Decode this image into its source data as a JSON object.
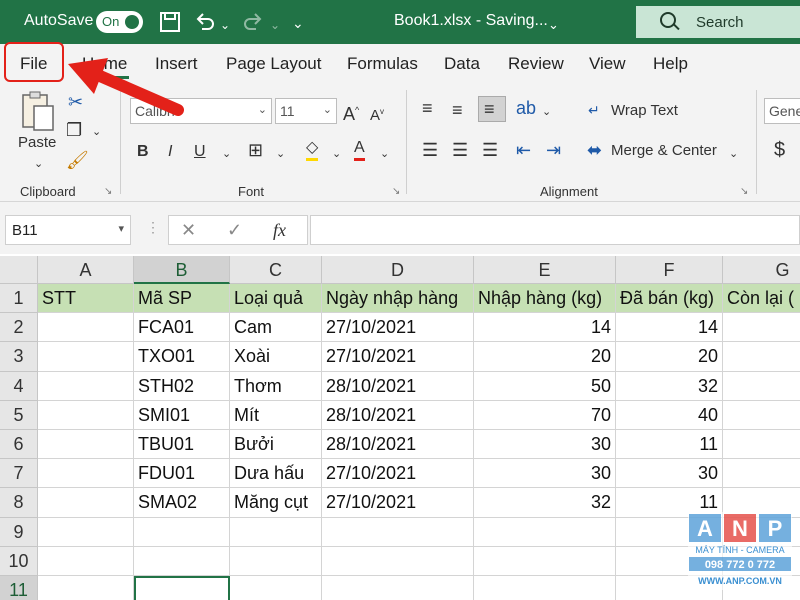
{
  "titlebar": {
    "autosave_label": "AutoSave",
    "autosave_state": "On",
    "doc_title": "Book1.xlsx  -  Saving...",
    "search_label": "Search"
  },
  "tabs": [
    "File",
    "Home",
    "Insert",
    "Page Layout",
    "Formulas",
    "Data",
    "Review",
    "View",
    "Help"
  ],
  "ribbon": {
    "clipboard": {
      "paste": "Paste",
      "label": "Clipboard"
    },
    "font": {
      "family": "Calibri",
      "size": "11",
      "label": "Font"
    },
    "alignment": {
      "wrap": "Wrap Text",
      "merge": "Merge & Center",
      "label": "Alignment"
    },
    "number": {
      "format": "Gene",
      "currency": "$"
    }
  },
  "formula_bar": {
    "name_box": "B11",
    "fx": "fx",
    "formula": ""
  },
  "sheet": {
    "columns": [
      "A",
      "B",
      "C",
      "D",
      "E",
      "F",
      "G"
    ],
    "selected_column": "B",
    "selected_row": "11",
    "rows": [
      {
        "num": "1",
        "cells": [
          "STT",
          "Mã SP",
          "Loại quả",
          "Ngày nhập hàng",
          "Nhập hàng (kg)",
          "Đã bán (kg)",
          "Còn lại ("
        ]
      },
      {
        "num": "2",
        "cells": [
          "",
          "FCA01",
          "Cam",
          "27/10/2021",
          "14",
          "14",
          ""
        ]
      },
      {
        "num": "3",
        "cells": [
          "",
          "TXO01",
          "Xoài",
          "27/10/2021",
          "20",
          "20",
          ""
        ]
      },
      {
        "num": "4",
        "cells": [
          "",
          "STH02",
          "Thơm",
          "28/10/2021",
          "50",
          "32",
          ""
        ]
      },
      {
        "num": "5",
        "cells": [
          "",
          "SMI01",
          "Mít",
          "28/10/2021",
          "70",
          "40",
          ""
        ]
      },
      {
        "num": "6",
        "cells": [
          "",
          "TBU01",
          "Bưởi",
          "28/10/2021",
          "30",
          "11",
          ""
        ]
      },
      {
        "num": "7",
        "cells": [
          "",
          "FDU01",
          "Dưa hấu",
          "27/10/2021",
          "30",
          "30",
          ""
        ]
      },
      {
        "num": "8",
        "cells": [
          "",
          "SMA02",
          "Măng cụt",
          "27/10/2021",
          "32",
          "11",
          ""
        ]
      },
      {
        "num": "9",
        "cells": [
          "",
          "",
          "",
          "",
          "",
          "",
          ""
        ]
      },
      {
        "num": "10",
        "cells": [
          "",
          "",
          "",
          "",
          "",
          "",
          ""
        ]
      },
      {
        "num": "11",
        "cells": [
          "",
          "",
          "",
          "",
          "",
          "",
          ""
        ]
      }
    ]
  },
  "watermark": {
    "letters": [
      "A",
      "N",
      "P"
    ],
    "line1": "MÁY TÍNH - CAMERA",
    "line2": "098 772 0 772",
    "line3": "WWW.ANP.COM.VN"
  },
  "colors": {
    "accent": "#217346",
    "header_fill": "#c6e0b4",
    "annotation": "#e32119"
  }
}
